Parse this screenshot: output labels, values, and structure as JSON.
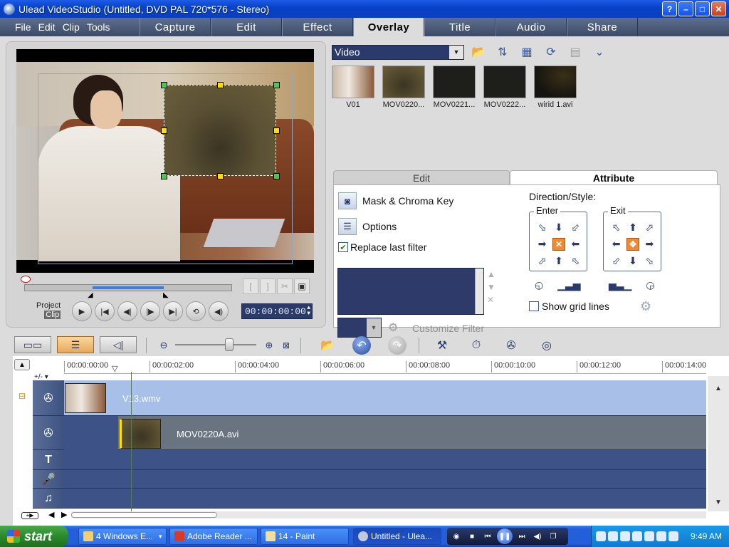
{
  "window": {
    "title": "Ulead VideoStudio (Untitled, DVD PAL 720*576 - Stereo)",
    "buttons": [
      "?",
      "–",
      "□",
      "✕"
    ]
  },
  "menu": [
    "File",
    "Edit",
    "Clip",
    "Tools"
  ],
  "steps": [
    {
      "label": "Capture",
      "active": false
    },
    {
      "label": "Edit",
      "active": false
    },
    {
      "label": "Effect",
      "active": false
    },
    {
      "label": "Overlay",
      "active": true
    },
    {
      "label": "Title",
      "active": false
    },
    {
      "label": "Audio",
      "active": false
    },
    {
      "label": "Share",
      "active": false
    }
  ],
  "preview": {
    "project_label": "Project",
    "clip_label": "Clip",
    "timecode": "00:00:00:00"
  },
  "library": {
    "selected": "Video",
    "items": [
      {
        "label": "V01"
      },
      {
        "label": "MOV0220..."
      },
      {
        "label": "MOV0221..."
      },
      {
        "label": "MOV0222..."
      },
      {
        "label": "wirid 1.avi"
      }
    ]
  },
  "attribute_panel": {
    "tabs": [
      {
        "label": "Edit",
        "active": false
      },
      {
        "label": "Attribute",
        "active": true
      }
    ],
    "mask_chroma": "Mask & Chroma Key",
    "options": "Options",
    "replace_last_filter": "Replace last filter",
    "replace_checked": true,
    "customize_filter": "Customize Filter",
    "direction_title": "Direction/Style:",
    "enter_label": "Enter",
    "exit_label": "Exit",
    "show_grid_lines": "Show grid lines"
  },
  "timeline": {
    "ruler": [
      "00:00:00:00",
      "00:00:02:00",
      "00:00:04:00",
      "00:00:06:00",
      "00:00:08:00",
      "00:00:10:00",
      "00:00:12:00",
      "00:00:14:00"
    ],
    "video_clip": "V13.wmv",
    "overlay_clip": "MOV0220A.avi",
    "playback_position": "00:00:00:00"
  },
  "taskbar": {
    "start": "start",
    "tasks": [
      {
        "label": "4 Windows E...",
        "active": false
      },
      {
        "label": "Adobe Reader ...",
        "active": false
      },
      {
        "label": "14 - Paint",
        "active": false
      },
      {
        "label": "Untitled - Ulea...",
        "active": true
      }
    ],
    "clock": "9:49 AM"
  }
}
